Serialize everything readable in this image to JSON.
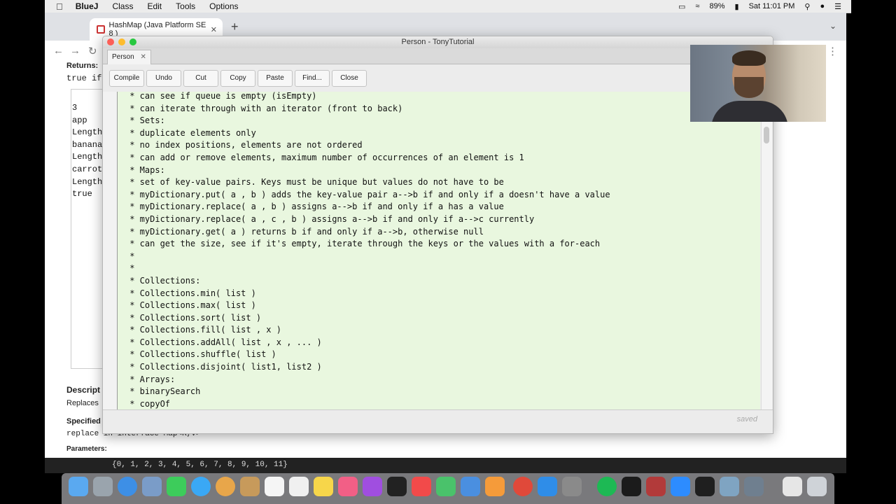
{
  "menubar": {
    "app": "BlueJ",
    "items": [
      "Class",
      "Edit",
      "Tools",
      "Options"
    ],
    "battery": "89%",
    "clock": "Sat 11:01 PM"
  },
  "browser": {
    "tab_title": "HashMap (Java Platform SE 8 )",
    "doc": {
      "returns_label": "Returns:",
      "returns_text": "true if",
      "description_label": "Descript",
      "replaces_text": "Replaces",
      "specified_label": "Specified",
      "specified_text": "replace in interface Map<K,V>",
      "parameters_label": "Parameters:"
    }
  },
  "terminal": {
    "lines": [
      "3",
      "app",
      "Length",
      "banana",
      "Length",
      "carrot",
      "Length",
      "true"
    ],
    "bottom_output": "{0, 1, 2, 3, 4, 5, 6, 7, 8, 9, 10, 11}"
  },
  "editor": {
    "window_title": "Person - TonyTutorial",
    "tab_label": "Person",
    "buttons": [
      "Compile",
      "Undo",
      "Cut",
      "Copy",
      "Paste",
      "Find...",
      "Close"
    ],
    "status": "saved",
    "code_lines": [
      " * can see if queue is empty (isEmpty)",
      " * can iterate through with an iterator (front to back)",
      " * Sets:",
      " * duplicate elements only",
      " * no index positions, elements are not ordered",
      " * can add or remove elements, maximum number of occurrences of an element is 1",
      " * Maps:",
      " * set of key-value pairs. Keys must be unique but values do not have to be",
      " * myDictionary.put( a , b ) adds the key-value pair a-->b if and only if a doesn't have a value",
      " * myDictionary.replace( a , b ) assigns a-->b if and only if a has a value",
      " * myDictionary.replace( a , c , b ) assigns a-->b if and only if a-->c currently",
      " * myDictionary.get( a ) returns b if and only if a-->b, otherwise null",
      " * can get the size, see if it's empty, iterate through the keys or the values with a for-each",
      " *",
      " *",
      " * Collections:",
      " * Collections.min( list )",
      " * Collections.max( list )",
      " * Collections.sort( list )",
      " * Collections.fill( list , x )",
      " * Collections.addAll( list , x , ... )",
      " * Collections.shuffle( list )",
      " * Collections.disjoint( list1, list2 )",
      " * Arrays:",
      " * binarySearch",
      " * copyOf"
    ]
  },
  "colors": {
    "code_bg": "#e9f7df",
    "menubar_bg": "#ececec",
    "traffic_red": "#fc5f57",
    "traffic_yellow": "#fdbc2e",
    "traffic_green": "#28c840"
  }
}
